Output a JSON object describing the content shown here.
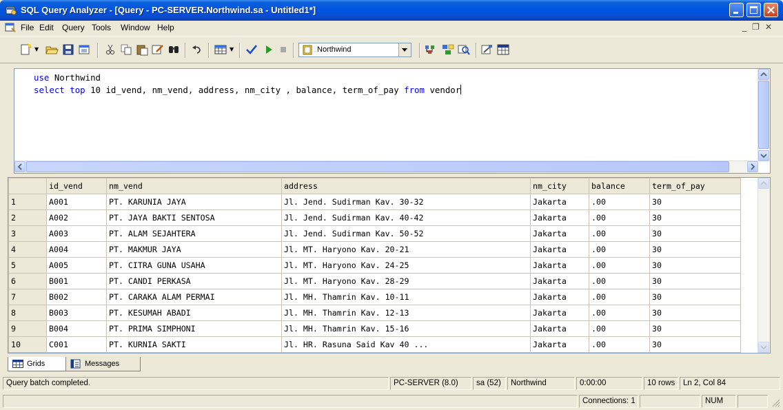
{
  "window": {
    "title": "SQL Query Analyzer - [Query - PC-SERVER.Northwind.sa - Untitled1*]"
  },
  "menu": [
    "File",
    "Edit",
    "Query",
    "Tools",
    "Window",
    "Help"
  ],
  "toolbar": {
    "database": "Northwind"
  },
  "editor": {
    "line1": {
      "kw": "use",
      "rest": " Northwind"
    },
    "line2": {
      "kw1": "select",
      "mid1": " ",
      "kw2": "top",
      "mid2": " 10 id_vend, nm_vend, address, nm_city , balance, term_of_pay ",
      "kw3": "from",
      "rest": " vendor"
    }
  },
  "grid": {
    "columns": [
      "id_vend",
      "nm_vend",
      "address",
      "nm_city",
      "balance",
      "term_of_pay"
    ],
    "rows": [
      [
        "1",
        "A001",
        "PT. KARUNIA JAYA",
        "Jl. Jend. Sudirman Kav. 30-32",
        "Jakarta",
        ".00",
        "30"
      ],
      [
        "2",
        "A002",
        "PT. JAYA BAKTI SENTOSA",
        "Jl. Jend. Sudirman Kav. 40-42",
        "Jakarta",
        ".00",
        "30"
      ],
      [
        "3",
        "A003",
        "PT. ALAM SEJAHTERA",
        "Jl. Jend. Sudirman Kav. 50-52",
        "Jakarta",
        ".00",
        "30"
      ],
      [
        "4",
        "A004",
        "PT. MAKMUR JAYA",
        "Jl. MT. Haryono Kav. 20-21",
        "Jakarta",
        ".00",
        "30"
      ],
      [
        "5",
        "A005",
        "PT. CITRA GUNA USAHA",
        "Jl. MT. Haryono Kav. 24-25",
        "Jakarta",
        ".00",
        "30"
      ],
      [
        "6",
        "B001",
        "PT. CANDI PERKASA",
        "Jl. MT. Haryono Kav. 28-29",
        "Jakarta",
        ".00",
        "30"
      ],
      [
        "7",
        "B002",
        "PT. CARAKA ALAM PERMAI",
        "Jl. MH. Thamrin Kav. 10-11",
        "Jakarta",
        ".00",
        "30"
      ],
      [
        "8",
        "B003",
        "PT. KESUMAH ABADI",
        "Jl. MH. Thamrin Kav. 12-13",
        "Jakarta",
        ".00",
        "30"
      ],
      [
        "9",
        "B004",
        "PT. PRIMA SIMPHONI",
        "Jl. MH. Thamrin Kav. 15-16",
        "Jakarta",
        ".00",
        "30"
      ],
      [
        "10",
        "C001",
        "PT. KURNIA SAKTI",
        "Jl. HR. Rasuna Said Kav 40 ...",
        "Jakarta",
        ".00",
        "30"
      ]
    ]
  },
  "tabs": {
    "grids": "Grids",
    "messages": "Messages"
  },
  "status": {
    "message": "Query batch completed.",
    "server": "PC-SERVER (8.0)",
    "user": "sa (52)",
    "database": "Northwind",
    "time": "0:00:00",
    "rows": "10 rows",
    "position": "Ln 2, Col 84",
    "connections": "Connections: 1",
    "num": "NUM"
  }
}
